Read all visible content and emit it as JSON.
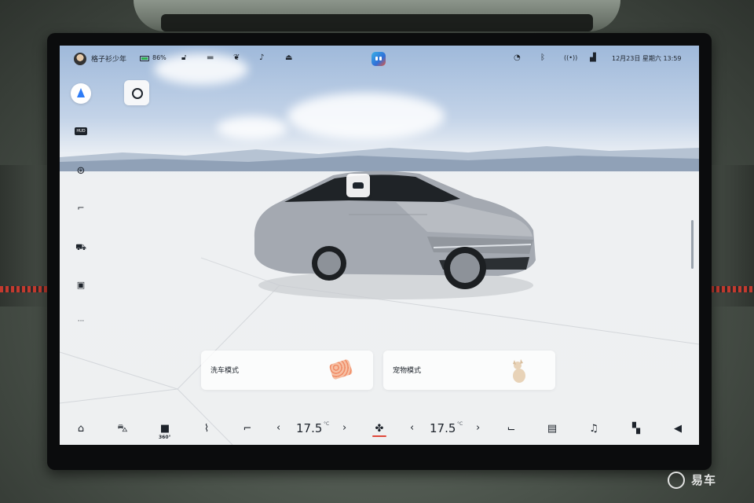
{
  "status_bar": {
    "username": "格子衫少年",
    "battery_percent": "86%",
    "datetime": "12月23日 星期六 13:59",
    "icons": [
      "avatar",
      "battery-icon",
      "lock-icon",
      "dashcam-icon",
      "leaf-icon",
      "bell-icon",
      "alarm-icon",
      "app-logo",
      "signal-wave-icon",
      "bluetooth-icon",
      "hotspot-icon",
      "cellular-icon"
    ]
  },
  "left_rail": {
    "hud_label": "HUD",
    "more_label": "···",
    "icons": [
      "navigation-icon",
      "scan-icon",
      "hud-icon",
      "steering-wheel-icon",
      "seat-icon",
      "car-mode-icon",
      "console-icon",
      "more-icon"
    ]
  },
  "modes": [
    {
      "label": "洗车模式",
      "icon": "sponge-icon"
    },
    {
      "label": "宠物模式",
      "icon": "dog-icon"
    }
  ],
  "dock": {
    "left_temp": "17.5",
    "right_temp": "17.5",
    "temp_unit": "°C",
    "chevron_left": "‹",
    "chevron_right": "›",
    "camera_360_label": "360°",
    "icons": [
      "home-icon",
      "car-icon",
      "camera-360-icon",
      "rear-defrost-icon",
      "driver-seat-icon",
      "fan-icon",
      "passenger-seat-icon",
      "defrost-icon",
      "music-icon",
      "apps-icon",
      "volume-icon"
    ],
    "fan_color": "#e0483a"
  },
  "watermark": "易车",
  "colors": {
    "accent": "#2e7cf6",
    "battery": "#2fb14e"
  }
}
